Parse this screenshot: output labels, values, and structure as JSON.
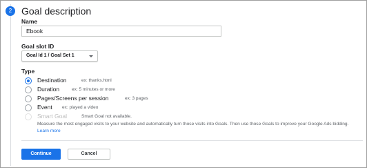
{
  "step": {
    "number": "2",
    "title": "Goal description"
  },
  "name_field": {
    "label": "Name",
    "value": "Ebook"
  },
  "slot_field": {
    "label": "Goal slot ID",
    "selected": "Goal Id 1 / Goal Set 1"
  },
  "type_field": {
    "label": "Type",
    "options": [
      {
        "label": "Destination",
        "hint": "ex: thanks.html",
        "checked": true
      },
      {
        "label": "Duration",
        "hint": "ex: 5 minutes or more",
        "checked": false
      },
      {
        "label": "Pages/Screens per session",
        "hint": "ex: 3 pages",
        "checked": false
      },
      {
        "label": "Event",
        "hint": "ex: played a video",
        "checked": false
      },
      {
        "label": "Smart Goal",
        "hint": "Smart Goal not available.",
        "checked": false,
        "disabled": true
      }
    ],
    "smart_goal_description": "Measure the most engaged visits to your website and automatically turn those visits into Goals. Then use those Goals to improve your Google Ads bidding.",
    "learn_more": "Learn more"
  },
  "actions": {
    "continue": "Continue",
    "cancel": "Cancel"
  },
  "colors": {
    "accent": "#1a73e8",
    "border": "#c4c7c5"
  }
}
